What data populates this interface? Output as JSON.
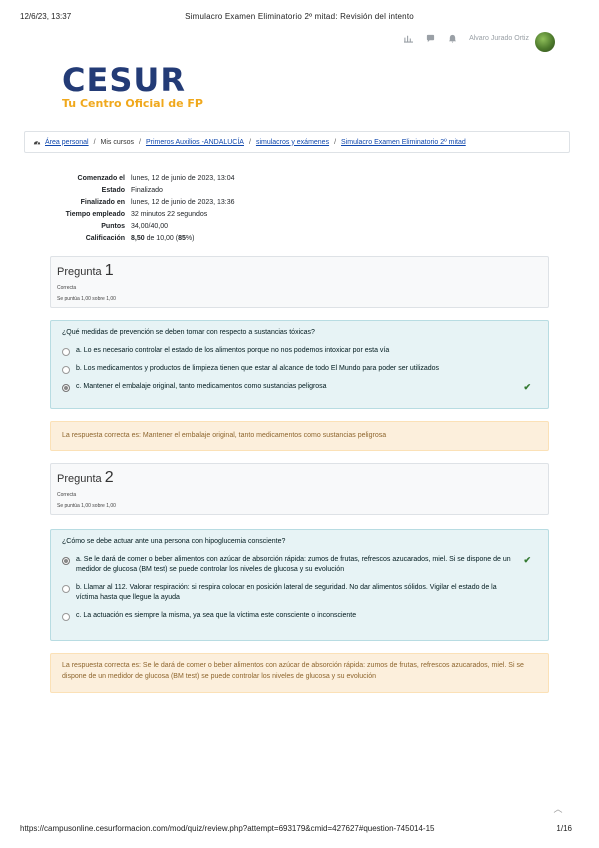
{
  "print_header": {
    "datetime": "12/6/23, 13:37",
    "title": "Simulacro Examen Eliminatorio 2º mitad: Revisión del intento"
  },
  "topbar": {
    "username": "Alvaro Jurado Ortiz"
  },
  "logo": {
    "line1": "CESUR",
    "line2": "Tu Centro Oficial de FP"
  },
  "breadcrumb": {
    "items": [
      "Área personal",
      "Mis cursos",
      "Primeros Auxilios -ANDALUCÍA",
      "simulacros y exámenes",
      "Simulacro Examen Eliminatorio 2º mitad"
    ]
  },
  "summary": {
    "rows": [
      {
        "k": "Comenzado el",
        "v": "lunes, 12 de junio de 2023, 13:04"
      },
      {
        "k": "Estado",
        "v": "Finalizado"
      },
      {
        "k": "Finalizado en",
        "v": "lunes, 12 de junio de 2023, 13:36"
      },
      {
        "k": "Tiempo empleado",
        "v": "32 minutos 22 segundos"
      },
      {
        "k": "Puntos",
        "v": "34,00/40,00"
      }
    ],
    "grade_label": "Calificación",
    "grade_value": "8,50",
    "grade_rest": " de 10,00 (",
    "grade_pct": "85",
    "grade_end": "%)"
  },
  "questions": [
    {
      "label": "Pregunta",
      "number": "1",
      "status": "Correcta",
      "grade": "Se puntúa 1,00 sobre 1,00",
      "prompt": "¿Qué medidas de prevención se deben tomar con respecto a sustancias tóxicas?",
      "answers": [
        "a. Lo es necesario controlar el estado de los alimentos porque no nos podemos intoxicar por esta vía",
        "b. Los medicamentos y productos de limpieza tienen que estar al alcance de todo El Mundo para poder ser utilizados",
        "c. Mantener el embalaje original, tanto medicamentos como sustancias peligrosa"
      ],
      "feedback": "La respuesta correcta es: Mantener el embalaje original, tanto medicamentos como sustancias peligrosa"
    },
    {
      "label": "Pregunta",
      "number": "2",
      "status": "Correcta",
      "grade": "Se puntúa 1,00 sobre 1,00",
      "prompt": "¿Cómo se debe actuar ante una persona con hipoglucemia consciente?",
      "answers": [
        "a. Se le dará de comer o beber alimentos con azúcar de absorción rápida: zumos de frutas, refrescos azucarados, miel. Si se dispone de un medidor de glucosa (BM test) se puede controlar los niveles de glucosa y su evolución",
        "b. Llamar al 112. Valorar respiración: si respira colocar en posición lateral de seguridad. No dar alimentos sólidos. Vigilar el estado de la víctima hasta que llegue la ayuda",
        "c. La actuación es siempre la misma, ya sea que la víctima este consciente o inconsciente"
      ],
      "feedback": "La respuesta correcta es: Se le dará de comer o beber alimentos con azúcar de absorción rápida: zumos de frutas, refrescos azucarados, miel. Si se dispone de un medidor de glucosa (BM test) se puede controlar los niveles de glucosa y su evolución"
    }
  ],
  "footer": {
    "url": "https://campusonline.cesurformacion.com/mod/quiz/review.php?attempt=693179&cmid=427627#question-745014-15",
    "page": "1/16"
  }
}
